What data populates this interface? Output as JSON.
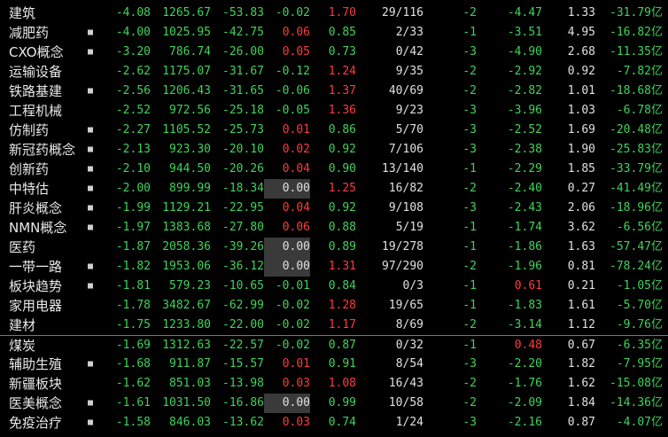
{
  "rows": [
    {
      "name": "建筑",
      "dot": "",
      "c1": "-4.08",
      "c2": "1265.67",
      "c3": "-53.83",
      "c4": "-0.02",
      "c5": "1.70",
      "c6": "29/116",
      "c7": "-2",
      "c8": "-4.47",
      "c9": "1.33",
      "c10": "-31.79亿",
      "c4c": "grn",
      "c5c": "red",
      "c8c": "grn"
    },
    {
      "name": "减肥药",
      "dot": "■",
      "c1": "-4.00",
      "c2": "1025.95",
      "c3": "-42.75",
      "c4": "0.06",
      "c5": "0.85",
      "c6": "2/33",
      "c7": "-1",
      "c8": "-3.51",
      "c9": "4.95",
      "c10": "-16.82亿",
      "c4c": "red",
      "c5c": "grn",
      "c8c": "grn"
    },
    {
      "name": "CXO概念",
      "dot": "■",
      "c1": "-3.20",
      "c2": "786.74",
      "c3": "-26.00",
      "c4": "0.05",
      "c5": "0.73",
      "c6": "0/42",
      "c7": "-3",
      "c8": "-4.90",
      "c9": "2.68",
      "c10": "-11.35亿",
      "c4c": "red",
      "c5c": "grn",
      "c8c": "grn"
    },
    {
      "name": "运输设备",
      "dot": "",
      "c1": "-2.62",
      "c2": "1175.07",
      "c3": "-31.67",
      "c4": "-0.12",
      "c5": "1.24",
      "c6": "9/35",
      "c7": "-2",
      "c8": "-2.92",
      "c9": "0.92",
      "c10": "-7.82亿",
      "c4c": "grn",
      "c5c": "red",
      "c8c": "grn"
    },
    {
      "name": "铁路基建",
      "dot": "■",
      "c1": "-2.56",
      "c2": "1206.43",
      "c3": "-31.65",
      "c4": "-0.06",
      "c5": "1.37",
      "c6": "40/69",
      "c7": "-2",
      "c8": "-2.82",
      "c9": "1.01",
      "c10": "-18.68亿",
      "c4c": "grn",
      "c5c": "red",
      "c8c": "grn"
    },
    {
      "name": "工程机械",
      "dot": "",
      "c1": "-2.52",
      "c2": "972.56",
      "c3": "-25.18",
      "c4": "-0.05",
      "c5": "1.36",
      "c6": "9/23",
      "c7": "-3",
      "c8": "-3.96",
      "c9": "1.03",
      "c10": "-6.78亿",
      "c4c": "grn",
      "c5c": "red",
      "c8c": "grn"
    },
    {
      "name": "仿制药",
      "dot": "■",
      "c1": "-2.27",
      "c2": "1105.52",
      "c3": "-25.73",
      "c4": "0.01",
      "c5": "0.86",
      "c6": "5/70",
      "c7": "-3",
      "c8": "-2.52",
      "c9": "1.69",
      "c10": "-20.48亿",
      "c4c": "red",
      "c5c": "grn",
      "c8c": "grn"
    },
    {
      "name": "新冠药概念",
      "dot": "■",
      "c1": "-2.13",
      "c2": "923.30",
      "c3": "-20.10",
      "c4": "0.02",
      "c5": "0.92",
      "c6": "7/106",
      "c7": "-3",
      "c8": "-2.38",
      "c9": "1.90",
      "c10": "-25.83亿",
      "c4c": "red",
      "c5c": "grn",
      "c8c": "grn"
    },
    {
      "name": "创新药",
      "dot": "■",
      "c1": "-2.10",
      "c2": "944.50",
      "c3": "-20.26",
      "c4": "0.04",
      "c5": "0.90",
      "c6": "13/140",
      "c7": "-1",
      "c8": "-2.29",
      "c9": "1.85",
      "c10": "-33.79亿",
      "c4c": "red",
      "c5c": "grn",
      "c8c": "grn"
    },
    {
      "name": "中特估",
      "dot": "■",
      "c1": "-2.00",
      "c2": "899.99",
      "c3": "-18.34",
      "c4": "0.00",
      "c5": "1.25",
      "c6": "16/82",
      "c7": "-2",
      "c8": "-2.40",
      "c9": "0.27",
      "c10": "-41.49亿",
      "c4c": "wht",
      "c5c": "red",
      "c8c": "grn"
    },
    {
      "name": "肝炎概念",
      "dot": "■",
      "c1": "-1.99",
      "c2": "1129.21",
      "c3": "-22.95",
      "c4": "0.04",
      "c5": "0.92",
      "c6": "9/108",
      "c7": "-3",
      "c8": "-2.43",
      "c9": "2.06",
      "c10": "-18.96亿",
      "c4c": "red",
      "c5c": "grn",
      "c8c": "grn"
    },
    {
      "name": "NMN概念",
      "dot": "■",
      "c1": "-1.97",
      "c2": "1383.68",
      "c3": "-27.80",
      "c4": "0.06",
      "c5": "0.88",
      "c6": "5/19",
      "c7": "-1",
      "c8": "-1.74",
      "c9": "3.62",
      "c10": "-6.56亿",
      "c4c": "red",
      "c5c": "grn",
      "c8c": "grn"
    },
    {
      "name": "医药",
      "dot": "",
      "c1": "-1.87",
      "c2": "2058.36",
      "c3": "-39.26",
      "c4": "0.00",
      "c5": "0.89",
      "c6": "19/278",
      "c7": "-1",
      "c8": "-1.86",
      "c9": "1.63",
      "c10": "-57.47亿",
      "c4c": "wht",
      "c5c": "grn",
      "c8c": "grn"
    },
    {
      "name": "一带一路",
      "dot": "■",
      "c1": "-1.82",
      "c2": "1953.06",
      "c3": "-36.12",
      "c4": "0.00",
      "c5": "1.31",
      "c6": "97/290",
      "c7": "-2",
      "c8": "-1.96",
      "c9": "0.81",
      "c10": "-78.24亿",
      "c4c": "wht",
      "c5c": "red",
      "c8c": "grn"
    },
    {
      "name": "板块趋势",
      "dot": "■",
      "c1": "-1.81",
      "c2": "579.23",
      "c3": "-10.65",
      "c4": "-0.01",
      "c5": "0.84",
      "c6": "0/3",
      "c7": "-1",
      "c8": "0.61",
      "c9": "0.21",
      "c10": "-1.05亿",
      "c4c": "grn",
      "c5c": "grn",
      "c8c": "red"
    },
    {
      "name": "家用电器",
      "dot": "",
      "c1": "-1.78",
      "c2": "3482.67",
      "c3": "-62.99",
      "c4": "-0.02",
      "c5": "1.28",
      "c6": "19/65",
      "c7": "-1",
      "c8": "-1.83",
      "c9": "1.61",
      "c10": "-5.70亿",
      "c4c": "grn",
      "c5c": "red",
      "c8c": "grn"
    },
    {
      "name": "建材",
      "dot": "",
      "c1": "-1.75",
      "c2": "1233.80",
      "c3": "-22.00",
      "c4": "-0.02",
      "c5": "1.17",
      "c6": "8/69",
      "c7": "-2",
      "c8": "-3.14",
      "c9": "1.12",
      "c10": "-9.76亿",
      "c4c": "grn",
      "c5c": "red",
      "c8c": "grn"
    },
    {
      "name": "煤炭",
      "dot": "",
      "c1": "-1.69",
      "c2": "1312.63",
      "c3": "-22.57",
      "c4": "-0.02",
      "c5": "0.87",
      "c6": "0/32",
      "c7": "-1",
      "c8": "0.48",
      "c9": "0.67",
      "c10": "-6.35亿",
      "c4c": "grn",
      "c5c": "grn",
      "c8c": "red",
      "sep": true
    },
    {
      "name": "辅助生殖",
      "dot": "■",
      "c1": "-1.68",
      "c2": "911.87",
      "c3": "-15.57",
      "c4": "0.01",
      "c5": "0.91",
      "c6": "8/54",
      "c7": "-3",
      "c8": "-2.20",
      "c9": "1.82",
      "c10": "-7.95亿",
      "c4c": "red",
      "c5c": "grn",
      "c8c": "grn"
    },
    {
      "name": "新疆板块",
      "dot": "",
      "c1": "-1.62",
      "c2": "851.03",
      "c3": "-13.98",
      "c4": "0.03",
      "c5": "1.08",
      "c6": "16/43",
      "c7": "-2",
      "c8": "-1.76",
      "c9": "1.62",
      "c10": "-15.08亿",
      "c4c": "red",
      "c5c": "red",
      "c8c": "grn"
    },
    {
      "name": "医美概念",
      "dot": "■",
      "c1": "-1.61",
      "c2": "1031.50",
      "c3": "-16.86",
      "c4": "0.00",
      "c5": "0.99",
      "c6": "10/58",
      "c7": "-2",
      "c8": "-2.09",
      "c9": "1.84",
      "c10": "-14.36亿",
      "c4c": "wht",
      "c5c": "grn",
      "c8c": "grn"
    },
    {
      "name": "免疫治疗",
      "dot": "■",
      "c1": "-1.58",
      "c2": "846.03",
      "c3": "-13.62",
      "c4": "0.03",
      "c5": "0.74",
      "c6": "1/24",
      "c7": "-3",
      "c8": "-2.16",
      "c9": "0.87",
      "c10": "-4.07亿",
      "c4c": "red",
      "c5c": "grn",
      "c8c": "grn"
    }
  ]
}
